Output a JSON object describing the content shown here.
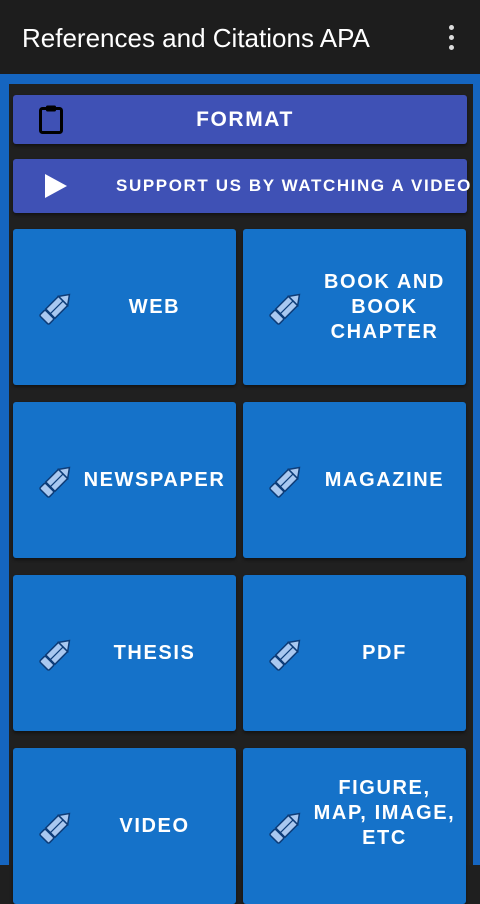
{
  "app": {
    "title": "References and Citations APA"
  },
  "icons": {
    "overflow": "more-vert-icon",
    "format": "clipboard-icon",
    "support": "play-icon",
    "tile": "pencil-icon"
  },
  "buttons": {
    "format": "FORMAT",
    "support": "SUPPORT US BY WATCHING A VIDEO"
  },
  "tiles": [
    {
      "label": "WEB"
    },
    {
      "label": "BOOK AND BOOK CHAPTER"
    },
    {
      "label": "NEWSPAPER"
    },
    {
      "label": "MAGAZINE"
    },
    {
      "label": "THESIS"
    },
    {
      "label": "PDF"
    },
    {
      "label": "VIDEO"
    },
    {
      "label": "FIGURE, MAP, IMAGE, ETC"
    }
  ],
  "colors": {
    "appbar": "#1d1d1d",
    "frame": "#1565c0",
    "button": "#3f51b5",
    "tile": "#1572c9",
    "icon": "#a9c8f0"
  }
}
